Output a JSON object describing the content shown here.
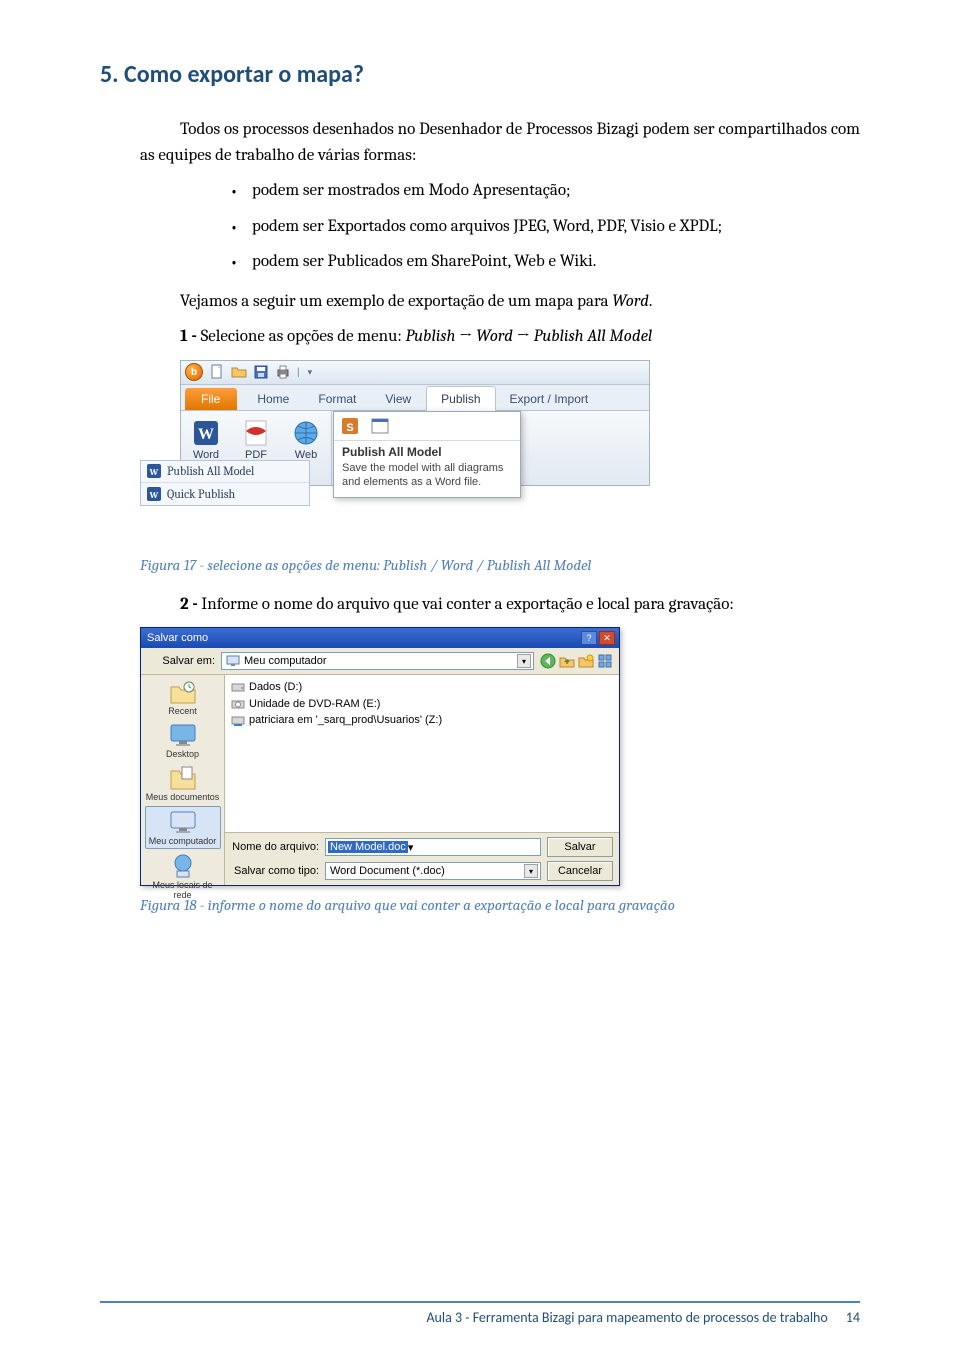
{
  "section_title": "5. Como exportar o mapa?",
  "intro": "Todos os processos desenhados no Desenhador de Processos Bizagi podem ser compartilhados com as equipes de trabalho de várias formas:",
  "bullets": [
    "podem ser mostrados em Modo Apresentação;",
    "podem ser Exportados como arquivos JPEG, Word, PDF, Visio e XPDL;",
    "podem ser Publicados em SharePoint, Web e Wiki."
  ],
  "para2a": "Vejamos a seguir um exemplo de exportação de um mapa para ",
  "para2b": "Word",
  "para2c": ".",
  "para3a": "1 - ",
  "para3b": "Selecione as opções de menu: ",
  "para3c": "Publish",
  "para3d": " → ",
  "para3e": "Word",
  "para3f": " → ",
  "para3g": "Publish All Model",
  "bizagi": {
    "tabs": {
      "file": "File",
      "home": "Home",
      "format": "Format",
      "view": "View",
      "publish": "Publish",
      "export": "Export / Import"
    },
    "buttons": {
      "word": "Word",
      "pdf": "PDF",
      "web": "Web"
    },
    "tooltip_title": "Publish All Model",
    "tooltip_body": "Save the model with all diagrams and elements as a Word file.",
    "side1": "Publish All Model",
    "side2": "Quick Publish"
  },
  "caption1": "Figura 17 - selecione as opções de menu: Publish / Word / Publish All Model",
  "para4a": "2 - ",
  "para4b": "Informe o nome do arquivo que vai conter a exportação e local para gravação:",
  "saveas": {
    "title": "Salvar como",
    "save_in_label": "Salvar em:",
    "save_in_value": "Meu computador",
    "drives": [
      "Dados (D:)",
      "Unidade de DVD-RAM (E:)",
      "patriciara em '_sarq_prod\\Usuarios' (Z:)"
    ],
    "places": [
      "Recent",
      "Desktop",
      "Meus documentos",
      "Meu computador",
      "Meus locais de rede"
    ],
    "filename_label": "Nome do arquivo:",
    "filename_value": "New Model.doc",
    "filetype_label": "Salvar como tipo:",
    "filetype_value": "Word Document (*.doc)",
    "btn_save": "Salvar",
    "btn_cancel": "Cancelar"
  },
  "caption2": "Figura 18 - informe o nome do arquivo que vai conter a exportação e local para gravação",
  "footer_text": "Aula 3 - Ferramenta Bizagi para mapeamento de processos de trabalho",
  "footer_page": "14"
}
